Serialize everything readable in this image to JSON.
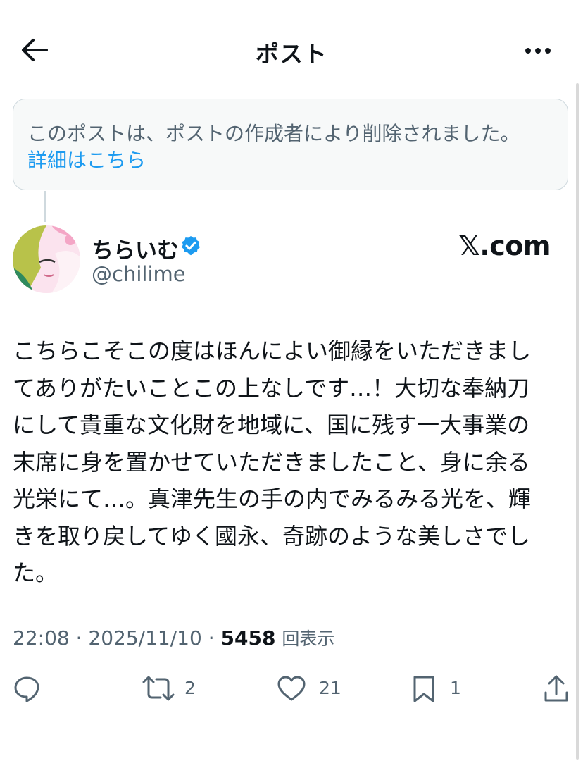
{
  "header": {
    "title": "ポスト",
    "back_icon": "arrow-left-icon",
    "more_icon": "more-horizontal-icon"
  },
  "deleted_notice": {
    "text": "このポストは、ポストの作成者により削除されました。",
    "link": "詳細はこちら"
  },
  "author": {
    "display_name": "ちらいむ",
    "handle": "@chilime",
    "verified": true
  },
  "watermark": "𝕏.com",
  "post": {
    "lines": [
      "こちらこそこの度はほんによい御縁をいただきまし",
      "てありがたいことこの上なしです…！大切な奉納刀",
      "にして貴重な文化財を地域に、国に残す一大事業の",
      "末席に身を置かせていただきましたこと、身に余る",
      "光栄にて…。真津先生の手の内でみるみる光を、輝",
      "きを取り戻してゆく國永、奇跡のような美しさでし",
      "た。"
    ]
  },
  "meta": {
    "time": "22:08",
    "date": "2025/11/10",
    "views_count": "5458",
    "views_label": "回表示"
  },
  "actions": {
    "reply": {
      "icon": "reply-icon",
      "count": ""
    },
    "repost": {
      "icon": "repost-icon",
      "count": "2"
    },
    "like": {
      "icon": "heart-icon",
      "count": "21"
    },
    "bookmark": {
      "icon": "bookmark-icon",
      "count": "1"
    },
    "share": {
      "icon": "share-icon",
      "count": ""
    }
  },
  "colors": {
    "accent": "#1d9bf0",
    "text": "#0f1419",
    "secondary": "#536471",
    "border": "#cfd9de"
  }
}
